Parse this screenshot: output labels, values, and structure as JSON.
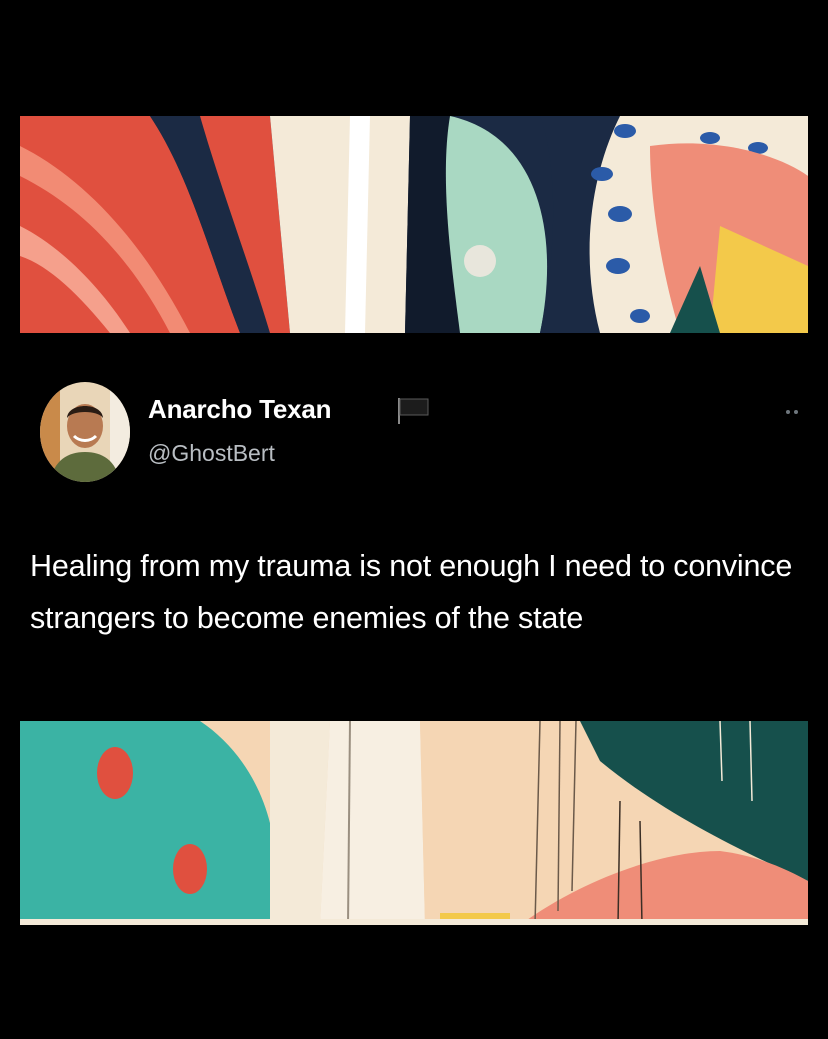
{
  "tweet": {
    "author_name": "Anarcho Texan",
    "author_handle": "@GhostBert",
    "text": "Healing from my trauma is not enough I need to convince strangers to become enemies of the state",
    "author_badge_icon": "black-flag-icon",
    "menu_icon": "more-dots-icon"
  },
  "colors": {
    "background": "#000000",
    "text_primary": "#ffffff",
    "text_secondary": "#b9bec3",
    "art_red": "#e0503f",
    "art_navy": "#1b2a44",
    "art_cream": "#f4ead8",
    "art_mint": "#a9d8c2",
    "art_teal": "#3bb3a4",
    "art_dark_teal": "#16504c",
    "art_salmon": "#ef8d78",
    "art_yellow": "#f3c94a",
    "art_peach": "#f5d6b4"
  }
}
